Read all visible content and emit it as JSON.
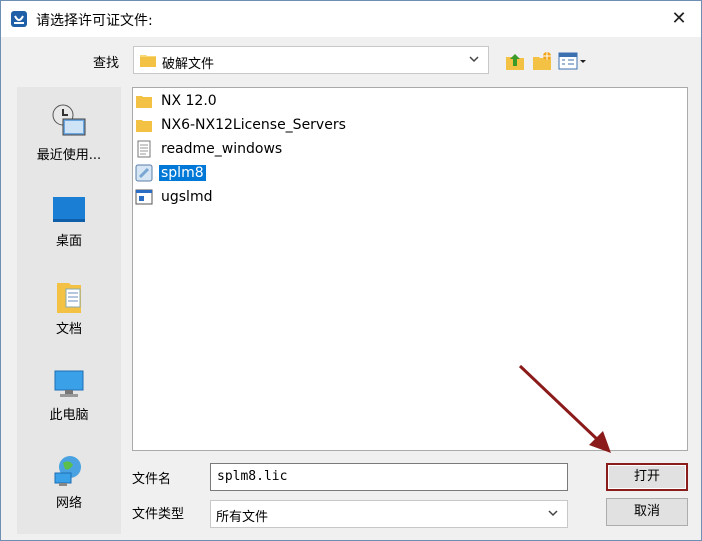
{
  "window": {
    "title": "请选择许可证文件:",
    "close_glyph": "✕"
  },
  "lookin": {
    "label": "查找",
    "value": "破解文件"
  },
  "toolbar": {
    "icons": [
      "up-folder-icon",
      "new-folder-icon",
      "view-menu-icon"
    ]
  },
  "places": [
    {
      "label": "最近使用...",
      "icon": "recent-icon"
    },
    {
      "label": "桌面",
      "icon": "desktop-icon"
    },
    {
      "label": "文档",
      "icon": "documents-icon"
    },
    {
      "label": "此电脑",
      "icon": "computer-icon"
    },
    {
      "label": "网络",
      "icon": "network-icon"
    }
  ],
  "files": [
    {
      "name": "NX 12.0",
      "icon": "folder-icon",
      "selected": false
    },
    {
      "name": "NX6-NX12License_Servers",
      "icon": "folder-icon",
      "selected": false
    },
    {
      "name": "readme_windows",
      "icon": "text-file-icon",
      "selected": false
    },
    {
      "name": "splm8",
      "icon": "license-file-icon",
      "selected": true
    },
    {
      "name": "ugslmd",
      "icon": "app-file-icon",
      "selected": false
    }
  ],
  "filename": {
    "label": "文件名",
    "value": "splm8.lic"
  },
  "filetype": {
    "label": "文件类型",
    "value": "所有文件"
  },
  "buttons": {
    "open": "打开",
    "cancel": "取消"
  },
  "colors": {
    "selection": "#0078d7",
    "highlight_border": "#8a1c1c",
    "annotation_arrow": "#8b1a1a"
  }
}
